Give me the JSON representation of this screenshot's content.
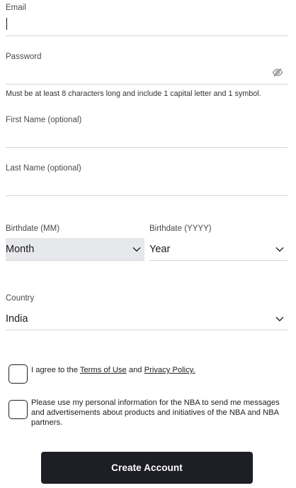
{
  "email": {
    "label": "Email",
    "value": ""
  },
  "password": {
    "label": "Password",
    "value": "",
    "hint": "Must be at least 8 characters long and include 1 capital letter and 1 symbol."
  },
  "first_name": {
    "label": "First Name (optional)",
    "value": ""
  },
  "last_name": {
    "label": "Last Name (optional)",
    "value": ""
  },
  "birth_month": {
    "label": "Birthdate (MM)",
    "value": "Month"
  },
  "birth_year": {
    "label": "Birthdate (YYYY)",
    "value": "Year"
  },
  "country": {
    "label": "Country",
    "value": "India"
  },
  "terms": {
    "prefix": "I agree to the ",
    "terms_link": "Terms of Use",
    "middle": " and ",
    "privacy_link": "Privacy Policy.",
    "checked": false
  },
  "marketing": {
    "text": "Please use my personal information for the NBA to send me messages and advertisements about products and initiatives of the NBA and NBA partners.",
    "checked": false
  },
  "submit_label": "Create Account",
  "colors": {
    "button_bg": "#1d1e26",
    "selected_select_bg": "#e7e8eb",
    "line": "#d4d4d4"
  },
  "icons": {
    "password_toggle": "eye-slash-icon",
    "dropdown": "chevron-down-icon"
  }
}
